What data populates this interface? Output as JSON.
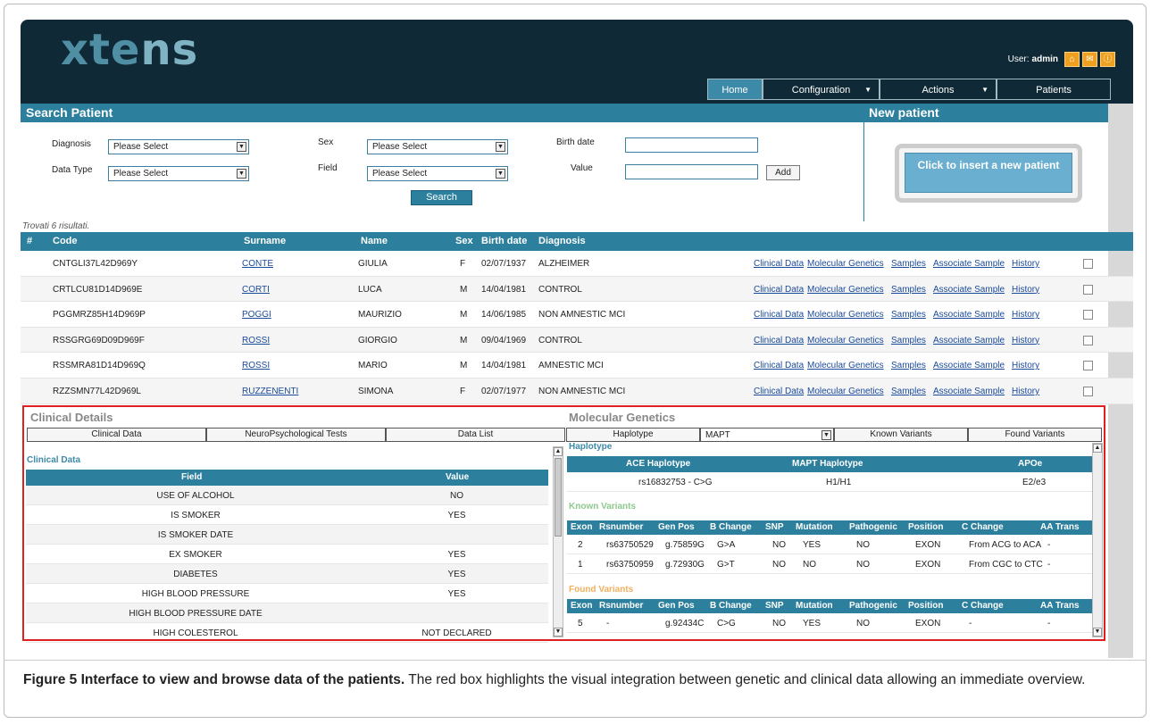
{
  "app": {
    "logo_main": "xte",
    "logo_soft": "ns",
    "user_label": "User:",
    "user_name": "admin",
    "nav": {
      "home": "Home",
      "configuration": "Configuration",
      "actions": "Actions",
      "patients": "Patients"
    }
  },
  "search": {
    "title": "Search Patient",
    "diagnosis_label": "Diagnosis",
    "diagnosis_value": "Please Select",
    "datatype_label": "Data Type",
    "datatype_value": "Please Select",
    "sex_label": "Sex",
    "sex_value": "Please Select",
    "field_label": "Field",
    "field_value": "Please Select",
    "birthdate_label": "Birth date",
    "value_label": "Value",
    "add_button": "Add",
    "search_button": "Search",
    "results_text": "Trovati 6 risultati."
  },
  "new_patient": {
    "title": "New patient",
    "button": "Click to insert a new patient"
  },
  "patients": {
    "headers": {
      "num": "#",
      "code": "Code",
      "surname": "Surname",
      "name": "Name",
      "sex": "Sex",
      "birth": "Birth date",
      "diagnosis": "Diagnosis"
    },
    "links": {
      "clinical": "Clinical Data",
      "molecular": "Molecular Genetics",
      "samples": "Samples",
      "associate": "Associate Sample",
      "history": "History"
    },
    "rows": [
      {
        "code": "CNTGLI37L42D969Y",
        "surname": "CONTE",
        "name": "GIULIA",
        "sex": "F",
        "birth": "02/07/1937",
        "diagnosis": "ALZHEIMER"
      },
      {
        "code": "CRTLCU81D14D969E",
        "surname": "CORTI",
        "name": "LUCA",
        "sex": "M",
        "birth": "14/04/1981",
        "diagnosis": "CONTROL"
      },
      {
        "code": "PGGMRZ85H14D969P",
        "surname": "POGGI",
        "name": "MAURIZIO",
        "sex": "M",
        "birth": "14/06/1985",
        "diagnosis": "NON AMNESTIC MCI"
      },
      {
        "code": "RSSGRG69D09D969F",
        "surname": "ROSSI",
        "name": "GIORGIO",
        "sex": "M",
        "birth": "09/04/1969",
        "diagnosis": "CONTROL"
      },
      {
        "code": "RSSMRA81D14D969Q",
        "surname": "ROSSI",
        "name": "MARIO",
        "sex": "M",
        "birth": "14/04/1981",
        "diagnosis": "AMNESTIC MCI"
      },
      {
        "code": "RZZSMN77L42D969L",
        "surname": "RUZZENENTI",
        "name": "SIMONA",
        "sex": "F",
        "birth": "02/07/1977",
        "diagnosis": "NON AMNESTIC MCI"
      }
    ]
  },
  "clinical": {
    "title": "Clinical Details",
    "tabs": [
      "Clinical Data",
      "NeuroPsychological Tests",
      "Data List"
    ],
    "subtitle": "Clinical Data",
    "field_header": "Field",
    "value_header": "Value",
    "rows": [
      {
        "field": "USE OF ALCOHOL",
        "value": "NO"
      },
      {
        "field": "IS SMOKER",
        "value": "YES"
      },
      {
        "field": "IS SMOKER DATE",
        "value": ""
      },
      {
        "field": "EX SMOKER",
        "value": "YES"
      },
      {
        "field": "DIABETES",
        "value": "YES"
      },
      {
        "field": "HIGH BLOOD PRESSURE",
        "value": "YES"
      },
      {
        "field": "HIGH BLOOD PRESSURE DATE",
        "value": ""
      },
      {
        "field": "HIGH COLESTEROL",
        "value": "NOT DECLARED"
      }
    ]
  },
  "molecular": {
    "title": "Molecular Genetics",
    "tab_haplotype": "Haplotype",
    "gene_select": "MAPT",
    "tab_known": "Known Variants",
    "tab_found": "Found Variants",
    "haplotype_title": "Haplotype",
    "haplotype_headers": [
      "ACE Haplotype",
      "MAPT Haplotype",
      "APOe"
    ],
    "haplotype_values": [
      "rs16832753 - C>G",
      "H1/H1",
      "E2/e3"
    ],
    "known_title": "Known Variants",
    "found_title": "Found Variants",
    "variant_headers": [
      "Exon",
      "Rsnumber",
      "Gen Pos",
      "B Change",
      "SNP",
      "Mutation",
      "Pathogenic",
      "Position",
      "C Change",
      "AA Trans"
    ],
    "known_rows": [
      [
        "2",
        "rs63750529",
        "g.75859G",
        "G>A",
        "NO",
        "YES",
        "NO",
        "EXON",
        "From ACG to ACA",
        "-"
      ],
      [
        "1",
        "rs63750959",
        "g.72930G",
        "G>T",
        "NO",
        "NO",
        "NO",
        "EXON",
        "From CGC to CTC",
        "-"
      ]
    ],
    "found_rows": [
      [
        "5",
        "-",
        "g.92434C",
        "C>G",
        "NO",
        "YES",
        "NO",
        "EXON",
        "-",
        "-"
      ]
    ]
  },
  "caption": {
    "bold": "Figure 5 Interface to view and browse data of the patients.",
    "text": " The red box highlights the visual integration between genetic and clinical data allowing an immediate overview."
  }
}
